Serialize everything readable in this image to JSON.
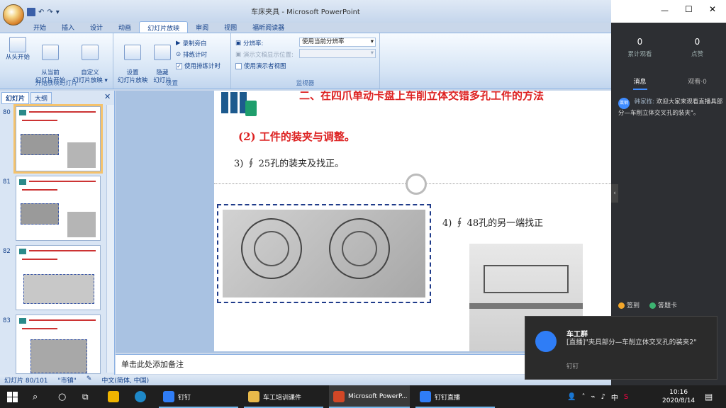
{
  "window": {
    "title": "车床夹具 - Microsoft PowerPoint",
    "controls": [
      "—",
      "☐",
      "✕"
    ]
  },
  "ribbon": {
    "tabs": [
      "开始",
      "插入",
      "设计",
      "动画",
      "幻灯片放映",
      "审阅",
      "视图",
      "福昕阅读器"
    ],
    "active_tab": "幻灯片放映",
    "groups": {
      "start_show": {
        "label": "开始放映幻灯片",
        "from_beginning": "从头开始",
        "from_current": "从当前\n幻灯片开始",
        "custom": "自定义\n幻灯片放映 ▾"
      },
      "setup": {
        "label": "设置",
        "setup_show": "设置\n幻灯片放映",
        "hide_slide": "隐藏\n幻灯片",
        "record_narration": "录制旁白",
        "rehearse": "排练计时",
        "use_timings": "使用排练计时"
      },
      "monitors": {
        "label": "监视器",
        "resolution_label": "分辨率:",
        "resolution_value": "使用当前分辨率",
        "show_on_label": "演示文稿显示位置:",
        "presenter_view": "使用演示者视图"
      }
    }
  },
  "left_pane": {
    "tabs": [
      "幻灯片",
      "大纲"
    ],
    "close": "✕",
    "slide_numbers": [
      "80",
      "81",
      "82",
      "83"
    ]
  },
  "slide": {
    "heading": "二、在四爪单动卡盘上车削立体交错多孔工件的方法",
    "subheading": "(2) 工件的装夹与调整。",
    "item3": "3) ∮ 25孔的装夹及找正。",
    "item4": "4) ∮ 48孔的另一端找正"
  },
  "notes": {
    "placeholder": "单击此处添加备注"
  },
  "statusbar": {
    "slide_info": "幻灯片 80/101",
    "theme": "\"市镇\"",
    "language": "中文(简体, 中国)"
  },
  "live_panel": {
    "total_views": "0",
    "total_views_label": "累计观看",
    "likes": "0",
    "likes_label": "点赞",
    "tab_messages": "消息",
    "tab_viewers": "观看·0",
    "message_avatar": "莱钢",
    "message_author": "韩家栋:",
    "message_text": "欢迎大家来观看直播具部分—车削立体交叉孔的装夹\"。",
    "checkin": "签到",
    "answer_card": "答题卡"
  },
  "toast": {
    "title": "车工群",
    "body": "[直播]\"夹具部分—车削立体交叉孔的装夹2\"",
    "app": "钉钉"
  },
  "taskbar": {
    "items": [
      {
        "label": "钉钉",
        "color": "#2f7df6"
      },
      {
        "label": "车工培训课件",
        "color": "#e8b94a"
      },
      {
        "label": "Microsoft PowerP...",
        "color": "#d24726"
      },
      {
        "label": "钉钉直播",
        "color": "#2f7df6"
      }
    ],
    "ime": "中",
    "time": "10:16",
    "date": "2020/8/14"
  }
}
